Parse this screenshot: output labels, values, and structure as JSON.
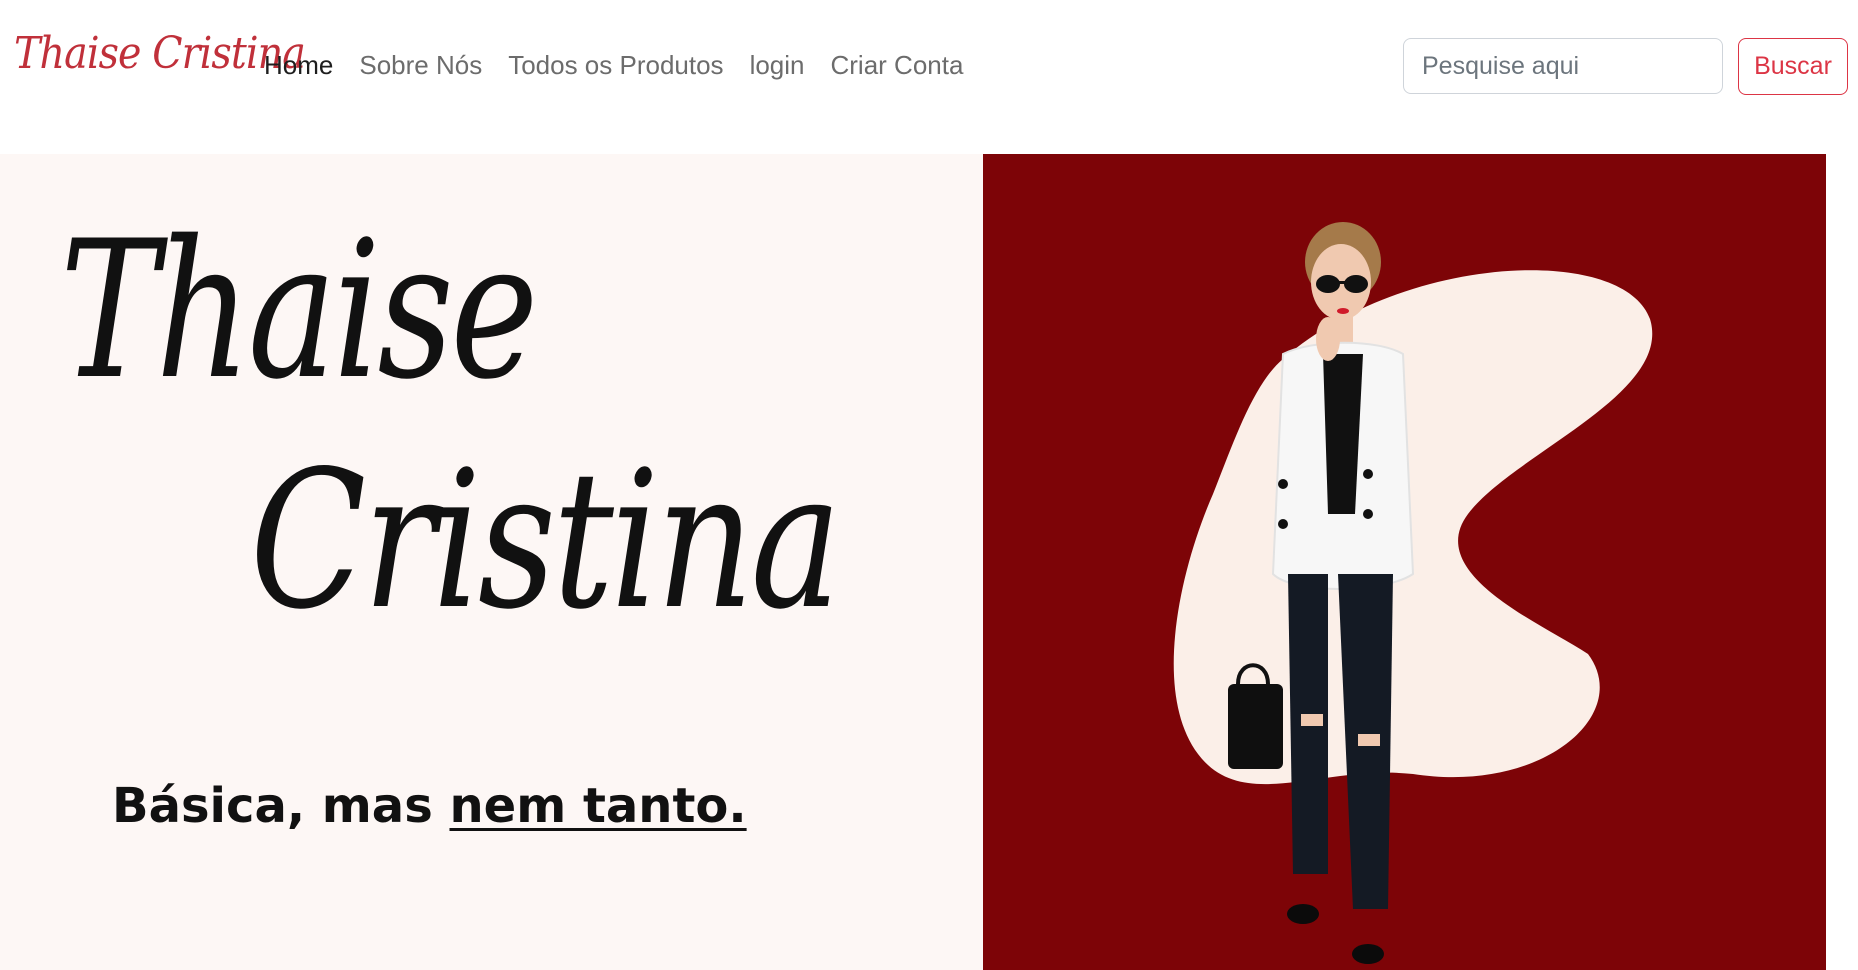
{
  "navbar": {
    "brand": "Thaise Cristina",
    "links": [
      {
        "label": "Home",
        "active": true
      },
      {
        "label": "Sobre Nós",
        "active": false
      },
      {
        "label": "Todos os Produtos",
        "active": false
      },
      {
        "label": "login",
        "active": false
      },
      {
        "label": "Criar Conta",
        "active": false
      }
    ],
    "search": {
      "placeholder": "Pesquise aqui",
      "value": ""
    },
    "search_button": "Buscar"
  },
  "hero": {
    "script_first": "Thaise",
    "script_last": "Cristina",
    "tagline_start": "Básica, mas ",
    "tagline_emphasis": "nem tanto.",
    "model_image": "woman-in-white-blazer-photo"
  },
  "colors": {
    "accent": "#dc3545",
    "brand": "#c0303a",
    "hero_left_bg": "#fdf7f5",
    "hero_right_bg": "#7d0407",
    "blob": "#fbefe8"
  }
}
